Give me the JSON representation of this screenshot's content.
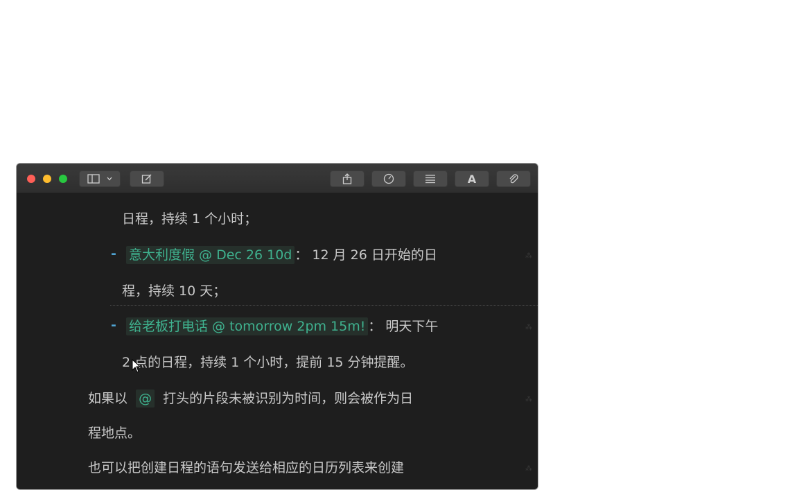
{
  "window": {
    "toolbar": {
      "sidebar_icon": "sidebar-icon",
      "chevron_icon": "chevron-down-icon",
      "compose_icon": "compose-icon",
      "share_icon": "share-icon",
      "gauge_icon": "gauge-icon",
      "list_icon": "list-icon",
      "font_label": "A",
      "attach_icon": "paperclip-icon"
    }
  },
  "editor": {
    "line1": "日程，持续 1 个小时；",
    "item2": {
      "bullet": "-",
      "tag": "意大利度假 @ Dec 26 10d",
      "text": "： 12 月 26 日开始的日"
    },
    "line3": "程，持续 10 天；",
    "item4": {
      "bullet": "-",
      "tag": "给老板打电话 @ tomorrow 2pm 15m!",
      "text": "： 明天下午"
    },
    "line5": "2 点的日程，持续 1 个小时，提前 15 分钟提醒。",
    "para1": {
      "pre": "如果以",
      "tag": "@",
      "post": "打头的片段未被识别为时间，则会被作为日"
    },
    "para1b": "程地点。",
    "para2": "也可以把创建日程的语句发送给相应的日历列表来创建"
  },
  "colors": {
    "background": "#1e1e1e",
    "text": "#c9c9c9",
    "accent_green": "#3fb28f",
    "bullet_blue": "#4fa3d1"
  }
}
